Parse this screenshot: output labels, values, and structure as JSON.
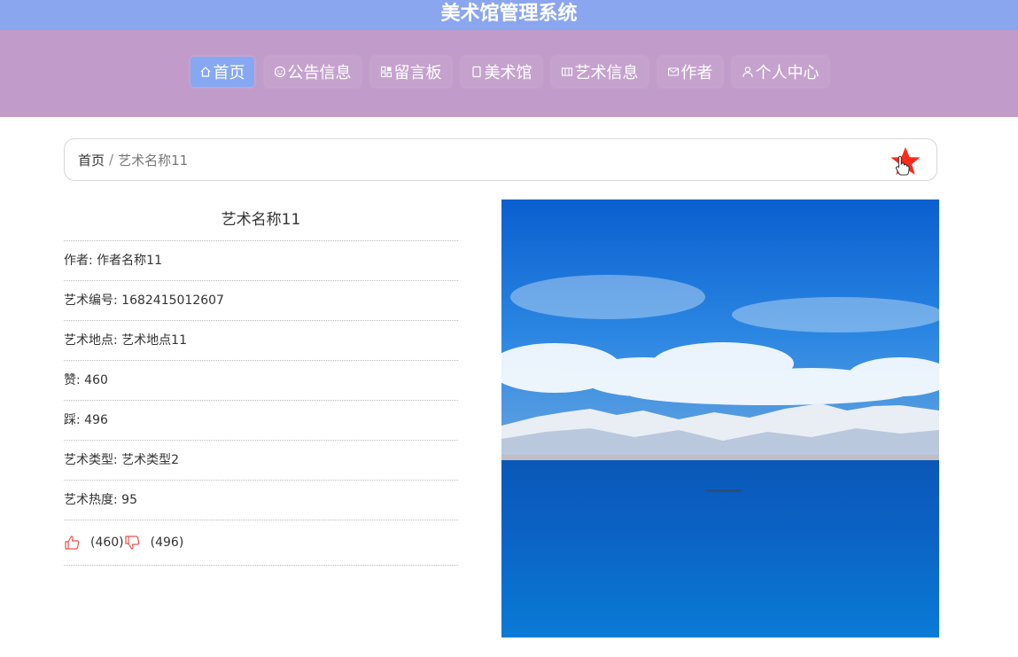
{
  "header": {
    "title": "美术馆管理系统"
  },
  "nav": {
    "items": [
      {
        "label": "首页",
        "icon": "home-icon"
      },
      {
        "label": "公告信息",
        "icon": "smile-icon"
      },
      {
        "label": "留言板",
        "icon": "grid-icon"
      },
      {
        "label": "美术馆",
        "icon": "square-icon"
      },
      {
        "label": "艺术信息",
        "icon": "film-icon"
      },
      {
        "label": "作者",
        "icon": "mail-icon"
      },
      {
        "label": "个人中心",
        "icon": "user-icon"
      }
    ],
    "active_index": 0
  },
  "breadcrumb": {
    "home": "首页",
    "separator": "/",
    "current": "艺术名称11",
    "favorite_icon": "star-icon"
  },
  "detail": {
    "title": "艺术名称11",
    "author": "作者: 作者名称11",
    "code": "艺术编号: 1682415012607",
    "location": "艺术地点: 艺术地点11",
    "likes": "赞: 460",
    "dislikes": "踩: 496",
    "type": "艺术类型: 艺术类型2",
    "heat": "艺术热度: 95",
    "like_count": "(460)",
    "dislike_count": "(496)"
  },
  "colors": {
    "title_bar": "#8aa6ee",
    "nav_bar": "#c19bc9",
    "active_nav": "#86a8f3",
    "star": "#ff2a1a",
    "vote_icon": "#e8534a"
  }
}
